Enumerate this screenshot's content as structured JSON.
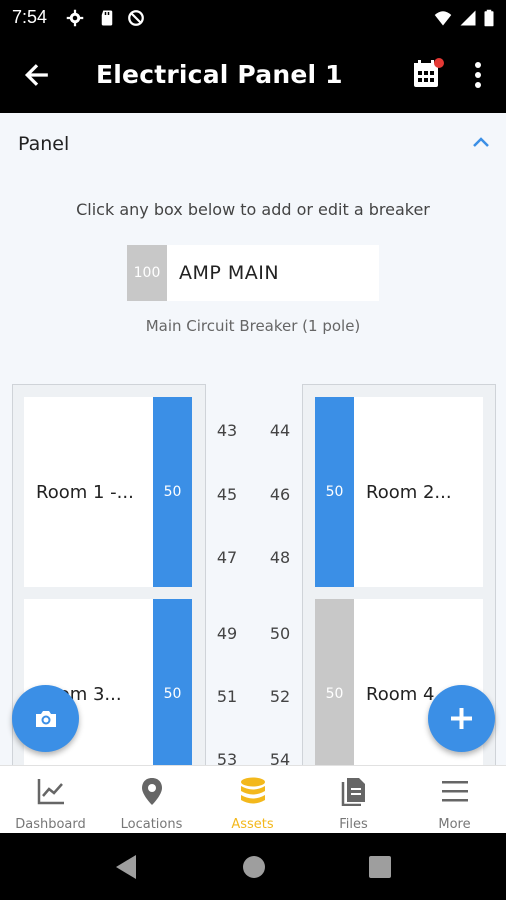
{
  "status_bar": {
    "time": "7:54"
  },
  "app_bar": {
    "title": "Electrical Panel 1"
  },
  "panel": {
    "header": "Panel",
    "hint": "Click any box below to add or edit a breaker",
    "main_breaker": {
      "amp": "100",
      "label": "AMP MAIN"
    },
    "main_caption": "Main Circuit Breaker (1 pole)"
  },
  "breakers_left": [
    {
      "name": "Room 1 -...",
      "amp": "50"
    },
    {
      "name": "Room 3...",
      "amp": "50"
    }
  ],
  "breakers_right": [
    {
      "name": "Room 2...",
      "amp": "50"
    },
    {
      "name": "Room 4",
      "amp": "50"
    }
  ],
  "slot_numbers": {
    "left": [
      "43",
      "45",
      "47",
      "49",
      "51",
      "53"
    ],
    "right": [
      "44",
      "46",
      "48",
      "50",
      "52",
      "54"
    ]
  },
  "bottom_nav": [
    {
      "label": "Dashboard",
      "icon": "chart-icon"
    },
    {
      "label": "Locations",
      "icon": "location-pin-icon"
    },
    {
      "label": "Assets",
      "icon": "database-icon"
    },
    {
      "label": "Files",
      "icon": "files-icon"
    },
    {
      "label": "More",
      "icon": "menu-icon"
    }
  ],
  "colors": {
    "accent": "#3b8fe6",
    "active_nav": "#f3b81c",
    "inactive_breaker": "#c8c8c8"
  }
}
